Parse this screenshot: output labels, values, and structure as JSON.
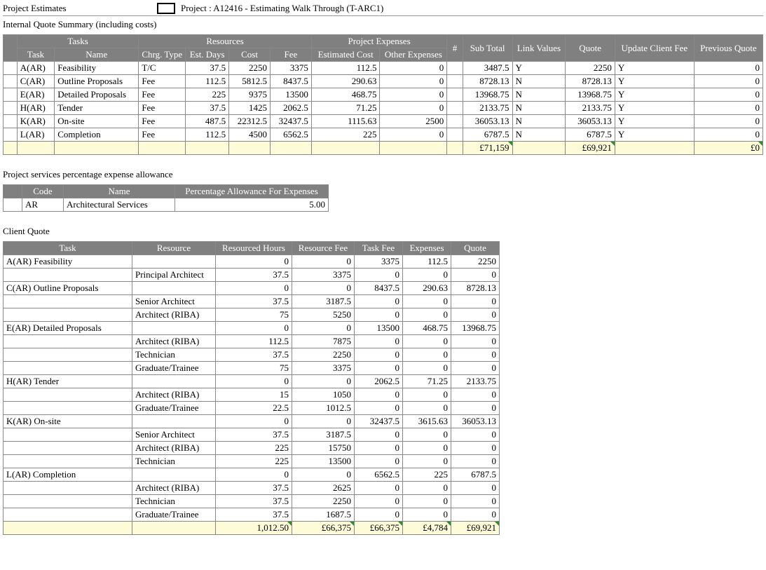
{
  "header": {
    "left": "Project Estimates",
    "project": "Project : A12416 - Estimating Walk Through (T-ARC1)"
  },
  "internal_quote": {
    "title": "Internal Quote Summary (including costs)",
    "group_headers": {
      "tasks": "Tasks",
      "resources": "Resources",
      "expenses": "Project Expenses"
    },
    "col_headers": {
      "task": "Task",
      "name": "Name",
      "chrg_type": "Chrg. Type",
      "est_days": "Est. Days",
      "cost": "Cost",
      "fee": "Fee",
      "est_cost": "Estimated Cost",
      "other_exp": "Other Expenses",
      "hash": "#",
      "sub_total": "Sub Total",
      "link_values": "Link Values",
      "quote": "Quote",
      "update_fee": "Update Client Fee",
      "prev_quote": "Previous Quote"
    },
    "rows": [
      {
        "task": "A(AR)",
        "name": "Feasibility",
        "ct": "T/C",
        "ed": "37.5",
        "cost": "2250",
        "fee": "3375",
        "ec": "112.5",
        "oe": "0",
        "st": "3487.5",
        "lv": "Y",
        "q": "2250",
        "ucf": "Y",
        "pq": "0"
      },
      {
        "task": "C(AR)",
        "name": "Outline Proposals",
        "ct": "Fee",
        "ed": "112.5",
        "cost": "5812.5",
        "fee": "8437.5",
        "ec": "290.63",
        "oe": "0",
        "st": "8728.13",
        "lv": "N",
        "q": "8728.13",
        "ucf": "Y",
        "pq": "0"
      },
      {
        "task": "E(AR)",
        "name": "Detailed Proposals",
        "ct": "Fee",
        "ed": "225",
        "cost": "9375",
        "fee": "13500",
        "ec": "468.75",
        "oe": "0",
        "st": "13968.75",
        "lv": "N",
        "q": "13968.75",
        "ucf": "Y",
        "pq": "0"
      },
      {
        "task": "H(AR)",
        "name": "Tender",
        "ct": "Fee",
        "ed": "37.5",
        "cost": "1425",
        "fee": "2062.5",
        "ec": "71.25",
        "oe": "0",
        "st": "2133.75",
        "lv": "N",
        "q": "2133.75",
        "ucf": "Y",
        "pq": "0"
      },
      {
        "task": "K(AR)",
        "name": "On-site",
        "ct": "Fee",
        "ed": "487.5",
        "cost": "22312.5",
        "fee": "32437.5",
        "ec": "1115.63",
        "oe": "2500",
        "st": "36053.13",
        "lv": "N",
        "q": "36053.13",
        "ucf": "Y",
        "pq": "0"
      },
      {
        "task": "L(AR)",
        "name": "Completion",
        "ct": "Fee",
        "ed": "112.5",
        "cost": "4500",
        "fee": "6562.5",
        "ec": "225",
        "oe": "0",
        "st": "6787.5",
        "lv": "N",
        "q": "6787.5",
        "ucf": "Y",
        "pq": "0"
      }
    ],
    "totals": {
      "sub_total": "£71,159",
      "quote": "£69,921",
      "prev_quote": "£0"
    }
  },
  "pct_allowance": {
    "title": "Project services percentage expense allowance",
    "headers": {
      "code": "Code",
      "name": "Name",
      "pct": "Percentage Allowance For Expenses"
    },
    "row": {
      "code": "AR",
      "name": "Architectural Services",
      "pct": "5.00"
    }
  },
  "client_quote": {
    "title": "Client Quote",
    "headers": {
      "task": "Task",
      "resource": "Resource",
      "hours": "Resourced Hours",
      "rfee": "Resource Fee",
      "tfee": "Task Fee",
      "exp": "Expenses",
      "quote": "Quote"
    },
    "rows": [
      {
        "task": "A(AR) Feasibility",
        "resource": "",
        "hours": "0",
        "rfee": "0",
        "tfee": "3375",
        "exp": "112.5",
        "quote": "2250"
      },
      {
        "task": "",
        "resource": "Principal Architect",
        "hours": "37.5",
        "rfee": "3375",
        "tfee": "0",
        "exp": "0",
        "quote": "0"
      },
      {
        "task": "C(AR) Outline Proposals",
        "resource": "",
        "hours": "0",
        "rfee": "0",
        "tfee": "8437.5",
        "exp": "290.63",
        "quote": "8728.13"
      },
      {
        "task": "",
        "resource": "Senior Architect",
        "hours": "37.5",
        "rfee": "3187.5",
        "tfee": "0",
        "exp": "0",
        "quote": "0"
      },
      {
        "task": "",
        "resource": "Architect (RIBA)",
        "hours": "75",
        "rfee": "5250",
        "tfee": "0",
        "exp": "0",
        "quote": "0"
      },
      {
        "task": "E(AR) Detailed Proposals",
        "resource": "",
        "hours": "0",
        "rfee": "0",
        "tfee": "13500",
        "exp": "468.75",
        "quote": "13968.75"
      },
      {
        "task": "",
        "resource": "Architect (RIBA)",
        "hours": "112.5",
        "rfee": "7875",
        "tfee": "0",
        "exp": "0",
        "quote": "0"
      },
      {
        "task": "",
        "resource": "Technician",
        "hours": "37.5",
        "rfee": "2250",
        "tfee": "0",
        "exp": "0",
        "quote": "0"
      },
      {
        "task": "",
        "resource": "Graduate/Trainee",
        "hours": "75",
        "rfee": "3375",
        "tfee": "0",
        "exp": "0",
        "quote": "0"
      },
      {
        "task": "H(AR) Tender",
        "resource": "",
        "hours": "0",
        "rfee": "0",
        "tfee": "2062.5",
        "exp": "71.25",
        "quote": "2133.75"
      },
      {
        "task": "",
        "resource": "Architect (RIBA)",
        "hours": "15",
        "rfee": "1050",
        "tfee": "0",
        "exp": "0",
        "quote": "0"
      },
      {
        "task": "",
        "resource": "Graduate/Trainee",
        "hours": "22.5",
        "rfee": "1012.5",
        "tfee": "0",
        "exp": "0",
        "quote": "0"
      },
      {
        "task": "K(AR) On-site",
        "resource": "",
        "hours": "0",
        "rfee": "0",
        "tfee": "32437.5",
        "exp": "3615.63",
        "quote": "36053.13"
      },
      {
        "task": "",
        "resource": "Senior Architect",
        "hours": "37.5",
        "rfee": "3187.5",
        "tfee": "0",
        "exp": "0",
        "quote": "0"
      },
      {
        "task": "",
        "resource": "Architect (RIBA)",
        "hours": "225",
        "rfee": "15750",
        "tfee": "0",
        "exp": "0",
        "quote": "0"
      },
      {
        "task": "",
        "resource": "Technician",
        "hours": "225",
        "rfee": "13500",
        "tfee": "0",
        "exp": "0",
        "quote": "0"
      },
      {
        "task": "L(AR) Completion",
        "resource": "",
        "hours": "0",
        "rfee": "0",
        "tfee": "6562.5",
        "exp": "225",
        "quote": "6787.5"
      },
      {
        "task": "",
        "resource": "Architect (RIBA)",
        "hours": "37.5",
        "rfee": "2625",
        "tfee": "0",
        "exp": "0",
        "quote": "0"
      },
      {
        "task": "",
        "resource": "Technician",
        "hours": "37.5",
        "rfee": "2250",
        "tfee": "0",
        "exp": "0",
        "quote": "0"
      },
      {
        "task": "",
        "resource": "Graduate/Trainee",
        "hours": "37.5",
        "rfee": "1687.5",
        "tfee": "0",
        "exp": "0",
        "quote": "0"
      }
    ],
    "totals": {
      "hours": "1,012.50",
      "rfee": "£66,375",
      "tfee": "£66,375",
      "exp": "£4,784",
      "quote": "£69,921"
    }
  }
}
